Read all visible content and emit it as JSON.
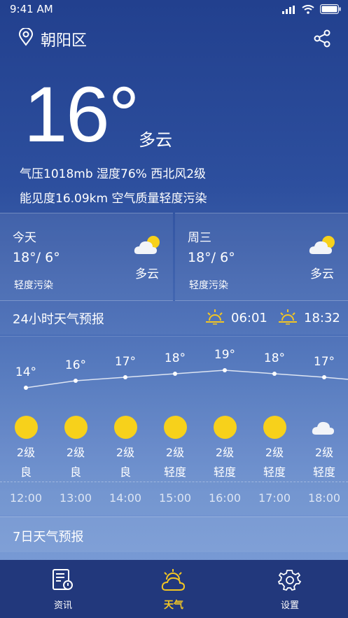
{
  "status_bar": {
    "time": "9:41 AM"
  },
  "header": {
    "location": "朝阳区"
  },
  "current": {
    "temp": "16°",
    "condition": "多云",
    "details_line1": "气压1018mb  湿度76%  西北风2级",
    "details_line2": "能见度16.09km  空气质量轻度污染"
  },
  "days": [
    {
      "name": "今天",
      "range": "18°/ 6°",
      "aq": "轻度污染",
      "cond": "多云",
      "icon": "partly-cloudy-icon"
    },
    {
      "name": "周三",
      "range": "18°/ 6°",
      "aq": "轻度污染",
      "cond": "多云",
      "icon": "partly-cloudy-icon"
    }
  ],
  "hourly_section": {
    "title": "24小时天气预报",
    "sunrise": "06:01",
    "sunset": "18:32"
  },
  "hourly": [
    {
      "temp": "14°",
      "t": 14,
      "wind": "2级",
      "aq": "良",
      "time": "12:00",
      "icon": "sun-icon"
    },
    {
      "temp": "16°",
      "t": 16,
      "wind": "2级",
      "aq": "良",
      "time": "13:00",
      "icon": "sun-icon"
    },
    {
      "temp": "17°",
      "t": 17,
      "wind": "2级",
      "aq": "良",
      "time": "14:00",
      "icon": "sun-icon"
    },
    {
      "temp": "18°",
      "t": 18,
      "wind": "2级",
      "aq": "轻度",
      "time": "15:00",
      "icon": "sun-icon"
    },
    {
      "temp": "19°",
      "t": 19,
      "wind": "2级",
      "aq": "轻度",
      "time": "16:00",
      "icon": "sun-icon"
    },
    {
      "temp": "18°",
      "t": 18,
      "wind": "2级",
      "aq": "轻度",
      "time": "17:00",
      "icon": "sun-icon"
    },
    {
      "temp": "17°",
      "t": 17,
      "wind": "2级",
      "aq": "轻度",
      "time": "18:00",
      "icon": "cloud-icon"
    }
  ],
  "week_section": {
    "title": "7日天气预报"
  },
  "tabs": [
    {
      "label": "资讯",
      "icon": "news-icon"
    },
    {
      "label": "天气",
      "icon": "weather-icon",
      "active": true
    },
    {
      "label": "设置",
      "icon": "gear-icon"
    }
  ],
  "colors": {
    "accent": "#f3c623",
    "sun": "#f7d11b",
    "tabbar": "#22387c"
  }
}
